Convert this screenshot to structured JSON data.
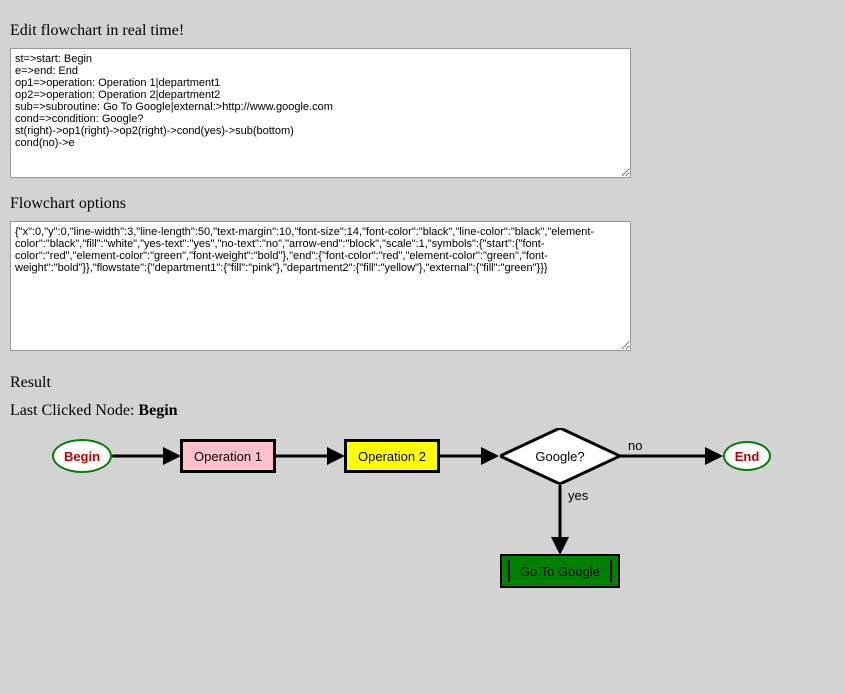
{
  "titles": {
    "editFlowchart": "Edit flowchart in real time!",
    "flowchartOptions": "Flowchart options",
    "result": "Result"
  },
  "code": "st=>start: Begin\ne=>end: End\nop1=>operation: Operation 1|department1\nop2=>operation: Operation 2|department2\nsub=>subroutine: Go To Google|external:>http://www.google.com\ncond=>condition: Google?\nst(right)->op1(right)->op2(right)->cond(yes)->sub(bottom)\ncond(no)->e",
  "options": "{\"x\":0,\"y\":0,\"line-width\":3,\"line-length\":50,\"text-margin\":10,\"font-size\":14,\"font-color\":\"black\",\"line-color\":\"black\",\"element-color\":\"black\",\"fill\":\"white\",\"yes-text\":\"yes\",\"no-text\":\"no\",\"arrow-end\":\"block\",\"scale\":1,\"symbols\":{\"start\":{\"font-color\":\"red\",\"element-color\":\"green\",\"font-weight\":\"bold\"},\"end\":{\"font-color\":\"red\",\"element-color\":\"green\",\"font-weight\":\"bold\"}},\"flowstate\":{\"department1\":{\"fill\":\"pink\"},\"department2\":{\"fill\":\"yellow\"},\"external\":{\"fill\":\"green\"}}}",
  "lastClicked": {
    "prefix": "Last Clicked Node: ",
    "value": "Begin"
  },
  "nodes": {
    "start": "Begin",
    "op1": "Operation 1",
    "op2": "Operation 2",
    "condition": "Google?",
    "end": "End",
    "sub": "Go To Google"
  },
  "edges": {
    "yes": "yes",
    "no": "no"
  },
  "chart_data": {
    "type": "flowchart",
    "nodes": [
      {
        "id": "st",
        "type": "start",
        "label": "Begin",
        "fill": "white",
        "font_color": "red",
        "element_color": "green",
        "font_weight": "bold"
      },
      {
        "id": "e",
        "type": "end",
        "label": "End",
        "fill": "white",
        "font_color": "red",
        "element_color": "green",
        "font_weight": "bold"
      },
      {
        "id": "op1",
        "type": "operation",
        "label": "Operation 1",
        "flowstate": "department1",
        "fill": "pink"
      },
      {
        "id": "op2",
        "type": "operation",
        "label": "Operation 2",
        "flowstate": "department2",
        "fill": "yellow"
      },
      {
        "id": "sub",
        "type": "subroutine",
        "label": "Go To Google",
        "flowstate": "external",
        "fill": "green",
        "link": "http://www.google.com"
      },
      {
        "id": "cond",
        "type": "condition",
        "label": "Google?",
        "fill": "white"
      }
    ],
    "edges": [
      {
        "from": "st",
        "to": "op1",
        "direction": "right"
      },
      {
        "from": "op1",
        "to": "op2",
        "direction": "right"
      },
      {
        "from": "op2",
        "to": "cond",
        "direction": "right"
      },
      {
        "from": "cond",
        "to": "sub",
        "label": "yes",
        "direction": "bottom"
      },
      {
        "from": "cond",
        "to": "e",
        "label": "no",
        "direction": "right"
      }
    ],
    "options": {
      "x": 0,
      "y": 0,
      "line-width": 3,
      "line-length": 50,
      "text-margin": 10,
      "font-size": 14,
      "font-color": "black",
      "line-color": "black",
      "element-color": "black",
      "fill": "white",
      "yes-text": "yes",
      "no-text": "no",
      "arrow-end": "block",
      "scale": 1
    }
  }
}
